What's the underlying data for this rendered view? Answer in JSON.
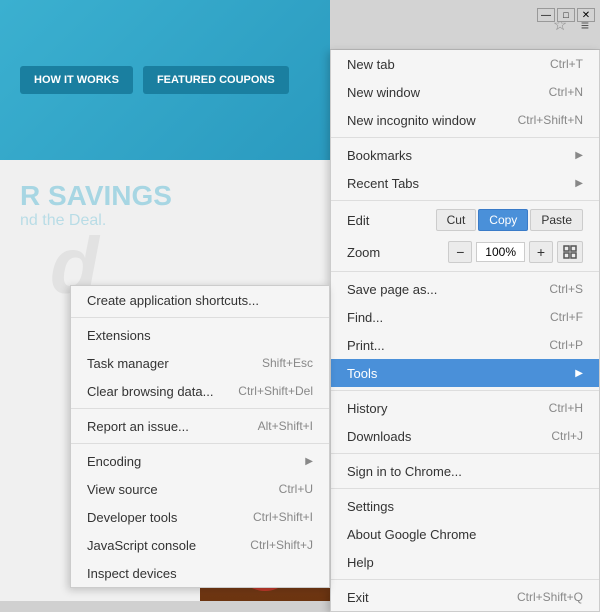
{
  "browser": {
    "star_icon": "☆",
    "menu_icon": "≡",
    "window_controls": {
      "minimize": "—",
      "maximize": "□",
      "close": "✕"
    }
  },
  "page": {
    "banner_btn1": "HOW IT WORKS",
    "banner_btn2": "FEATURED COUPONS",
    "savings_title": "R SAVINGS",
    "savings_sub": "nd the Deal.",
    "logo_watermark": "d"
  },
  "main_menu": {
    "items": [
      {
        "label": "New tab",
        "shortcut": "Ctrl+T",
        "has_arrow": false
      },
      {
        "label": "New window",
        "shortcut": "Ctrl+N",
        "has_arrow": false
      },
      {
        "label": "New incognito window",
        "shortcut": "Ctrl+Shift+N",
        "has_arrow": false
      },
      {
        "label": "Bookmarks",
        "shortcut": "",
        "has_arrow": true
      },
      {
        "label": "Recent Tabs",
        "shortcut": "",
        "has_arrow": true
      }
    ],
    "edit": {
      "label": "Edit",
      "cut": "Cut",
      "copy": "Copy",
      "paste": "Paste"
    },
    "zoom": {
      "label": "Zoom",
      "minus": "−",
      "value": "100%",
      "plus": "+",
      "fullscreen": "⤢"
    },
    "items2": [
      {
        "label": "Save page as...",
        "shortcut": "Ctrl+S"
      },
      {
        "label": "Find...",
        "shortcut": "Ctrl+F"
      },
      {
        "label": "Print...",
        "shortcut": "Ctrl+P"
      },
      {
        "label": "Tools",
        "shortcut": "",
        "has_arrow": true,
        "highlighted": true
      }
    ],
    "items3": [
      {
        "label": "History",
        "shortcut": "Ctrl+H"
      },
      {
        "label": "Downloads",
        "shortcut": "Ctrl+J"
      }
    ],
    "items4": [
      {
        "label": "Sign in to Chrome...",
        "shortcut": ""
      }
    ],
    "items5": [
      {
        "label": "Settings",
        "shortcut": ""
      },
      {
        "label": "About Google Chrome",
        "shortcut": ""
      },
      {
        "label": "Help",
        "shortcut": ""
      }
    ],
    "items6": [
      {
        "label": "Exit",
        "shortcut": "Ctrl+Shift+Q"
      }
    ]
  },
  "tools_submenu": {
    "items": [
      {
        "label": "Create application shortcuts...",
        "shortcut": ""
      },
      {
        "label": "Extensions",
        "shortcut": ""
      },
      {
        "label": "Task manager",
        "shortcut": "Shift+Esc"
      },
      {
        "label": "Clear browsing data...",
        "shortcut": "Ctrl+Shift+Del"
      },
      {
        "label": "Report an issue...",
        "shortcut": "Alt+Shift+I"
      },
      {
        "label": "Encoding",
        "shortcut": "",
        "has_arrow": true
      },
      {
        "label": "View source",
        "shortcut": "Ctrl+U"
      },
      {
        "label": "Developer tools",
        "shortcut": "Ctrl+Shift+I"
      },
      {
        "label": "JavaScript console",
        "shortcut": "Ctrl+Shift+J"
      },
      {
        "label": "Inspect devices",
        "shortcut": ""
      }
    ]
  }
}
